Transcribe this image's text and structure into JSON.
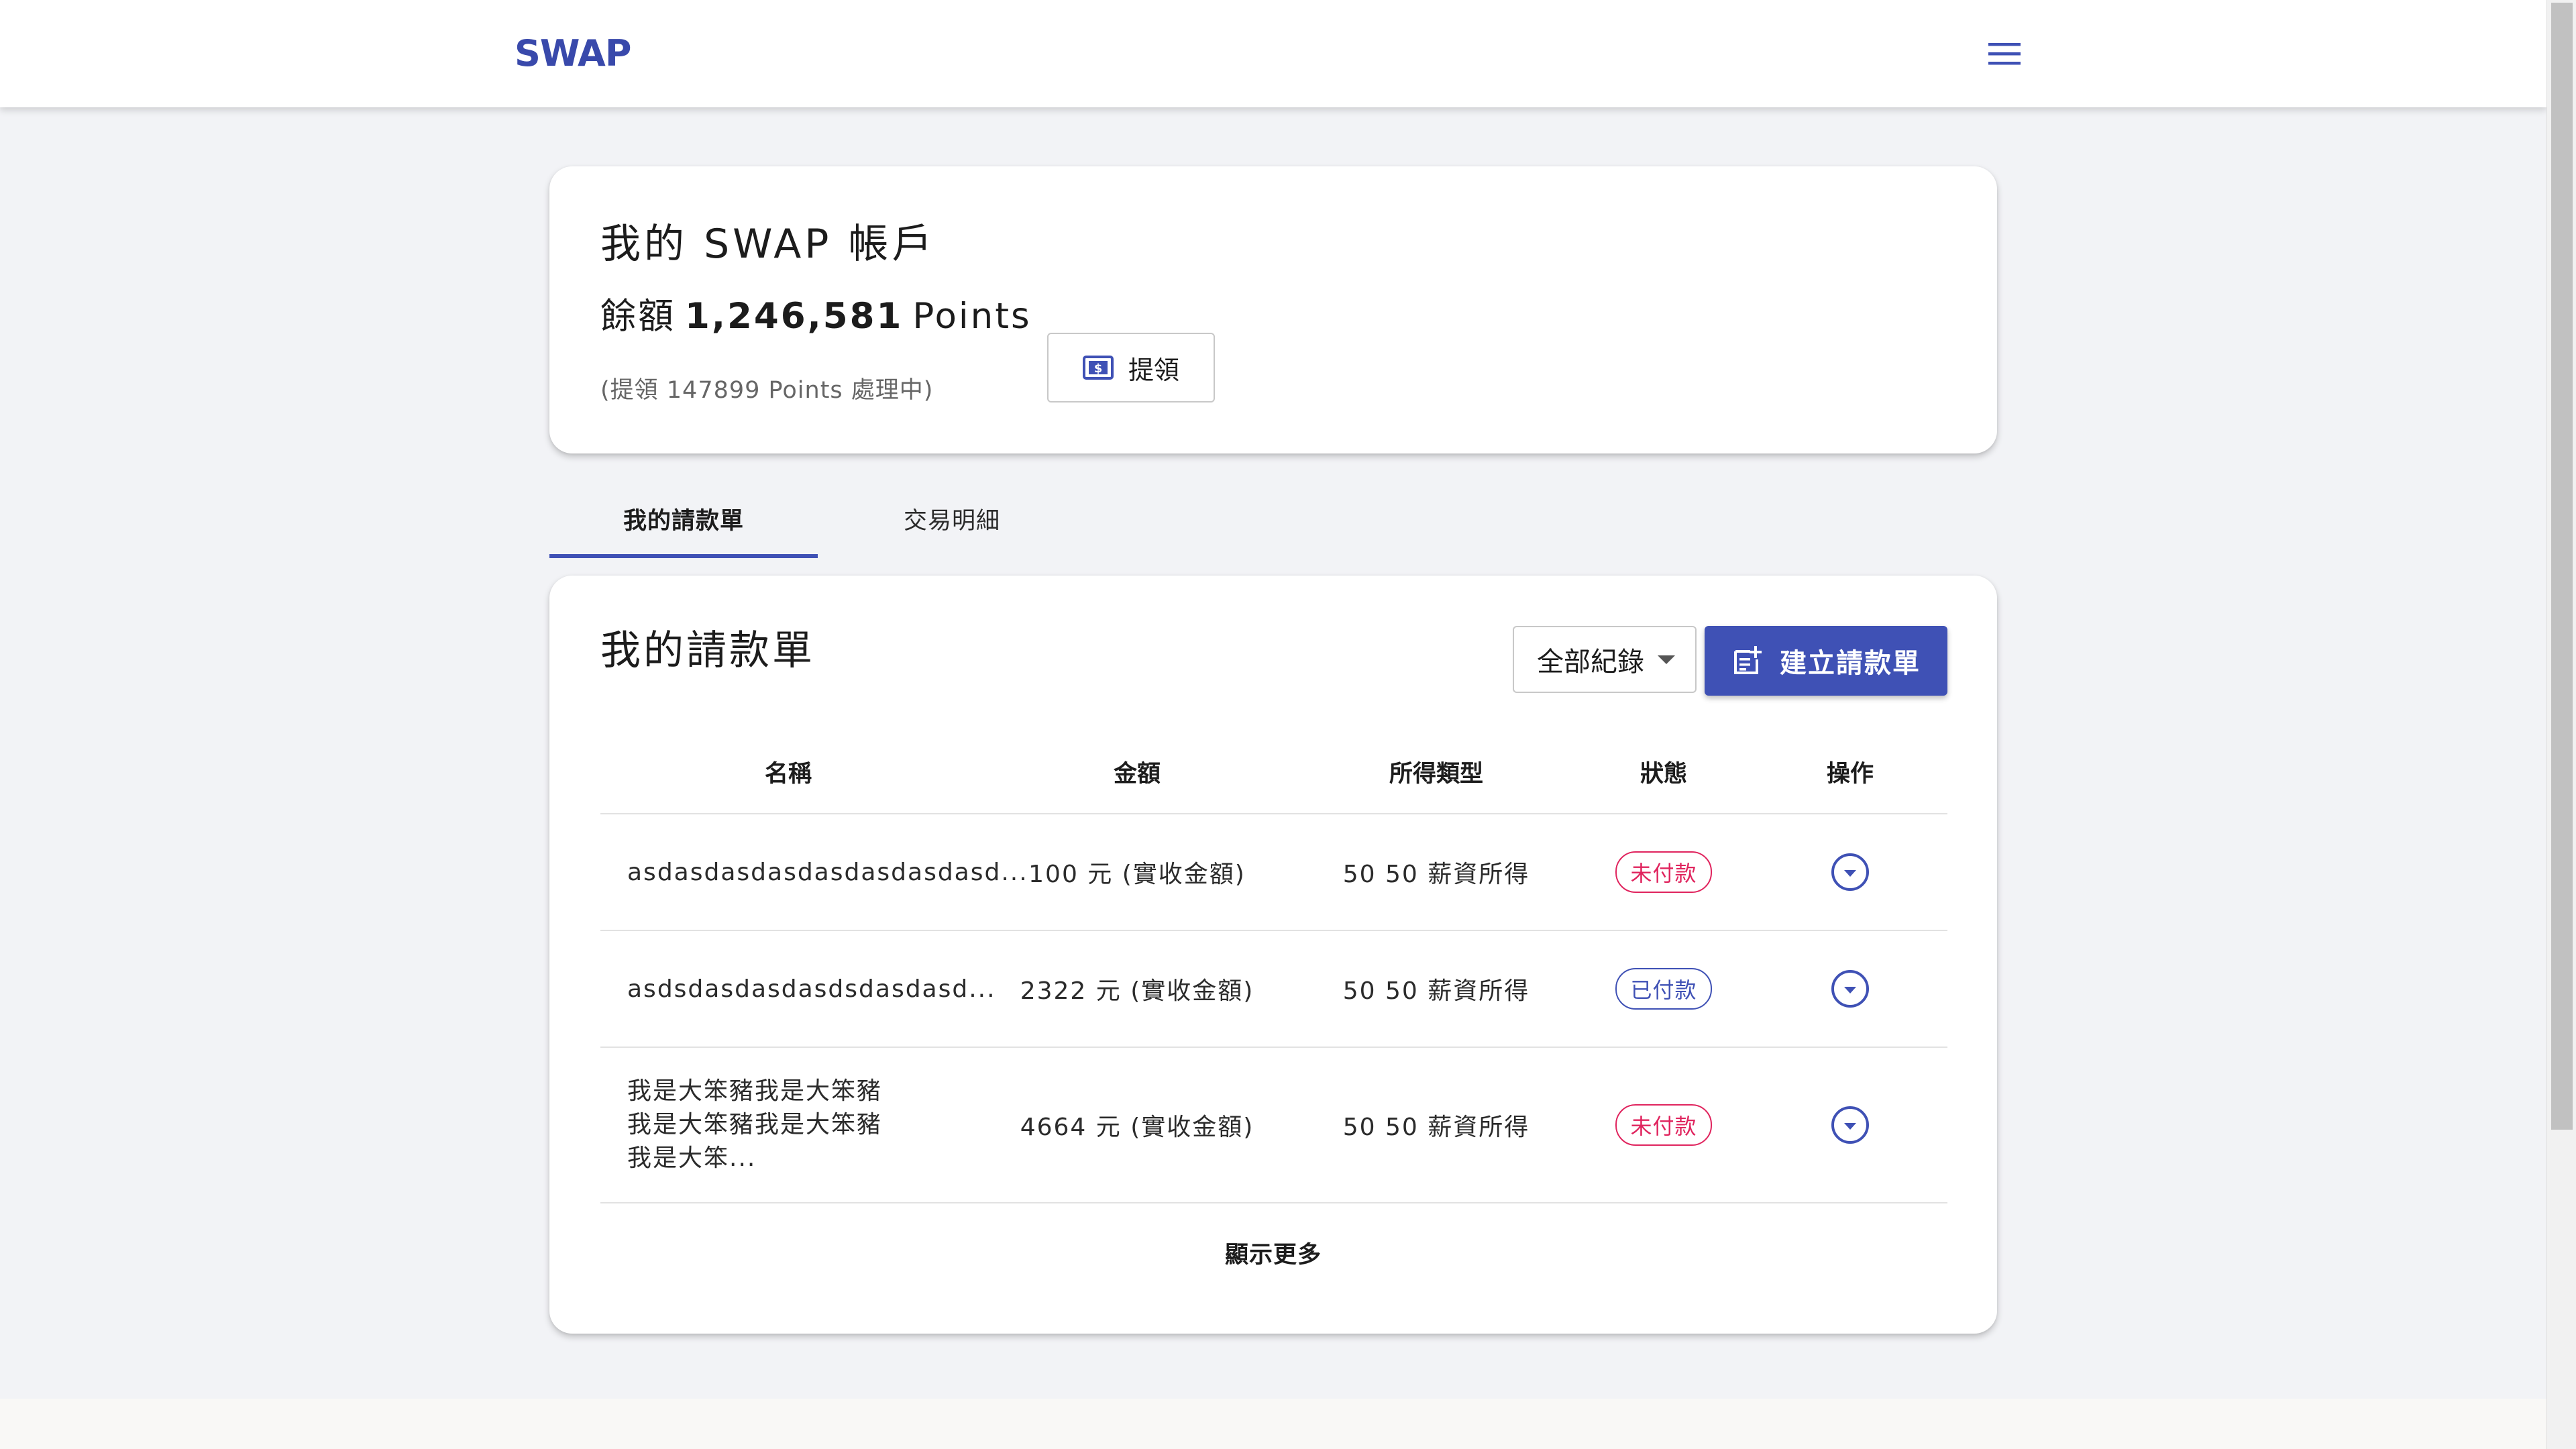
{
  "header": {
    "logo": "SWAP",
    "menu_icon": "hamburger-menu-icon"
  },
  "account": {
    "title": "我的 SWAP 帳戶",
    "balance_label": "餘額",
    "balance_value": "1,246,581",
    "balance_unit": "Points",
    "pending_note": "(提領 147899 Points 處理中)",
    "withdraw_label": "提領",
    "withdraw_icon": "dollar-bill-icon"
  },
  "tabs": [
    {
      "label": "我的請款單",
      "active": true
    },
    {
      "label": "交易明細",
      "active": false
    }
  ],
  "invoices": {
    "title": "我的請款單",
    "filter": {
      "selected": "全部紀錄"
    },
    "create_label": "建立請款單",
    "create_icon": "note-add-icon",
    "columns": [
      "名稱",
      "金額",
      "所得類型",
      "狀態",
      "操作"
    ],
    "rows": [
      {
        "name": "asdasdasdasdasdasdasdasd...",
        "amount": "100 元 (實收金額)",
        "type": "50 50 薪資所得",
        "status": "未付款",
        "status_kind": "unpaid"
      },
      {
        "name": "asdsdasdasdasdsdasdasd...",
        "amount": "2322 元 (實收金額)",
        "type": "50 50 薪資所得",
        "status": "已付款",
        "status_kind": "paid"
      },
      {
        "name": "我是大笨豬我是大笨豬我是大笨豬我是大笨豬我是大笨...",
        "amount": "4664 元 (實收金額)",
        "type": "50 50 薪資所得",
        "status": "未付款",
        "status_kind": "unpaid"
      }
    ],
    "show_more": "顯示更多"
  },
  "colors": {
    "primary": "#3f51b5",
    "unpaid": "#e0245e",
    "background": "#f2f3f6"
  }
}
